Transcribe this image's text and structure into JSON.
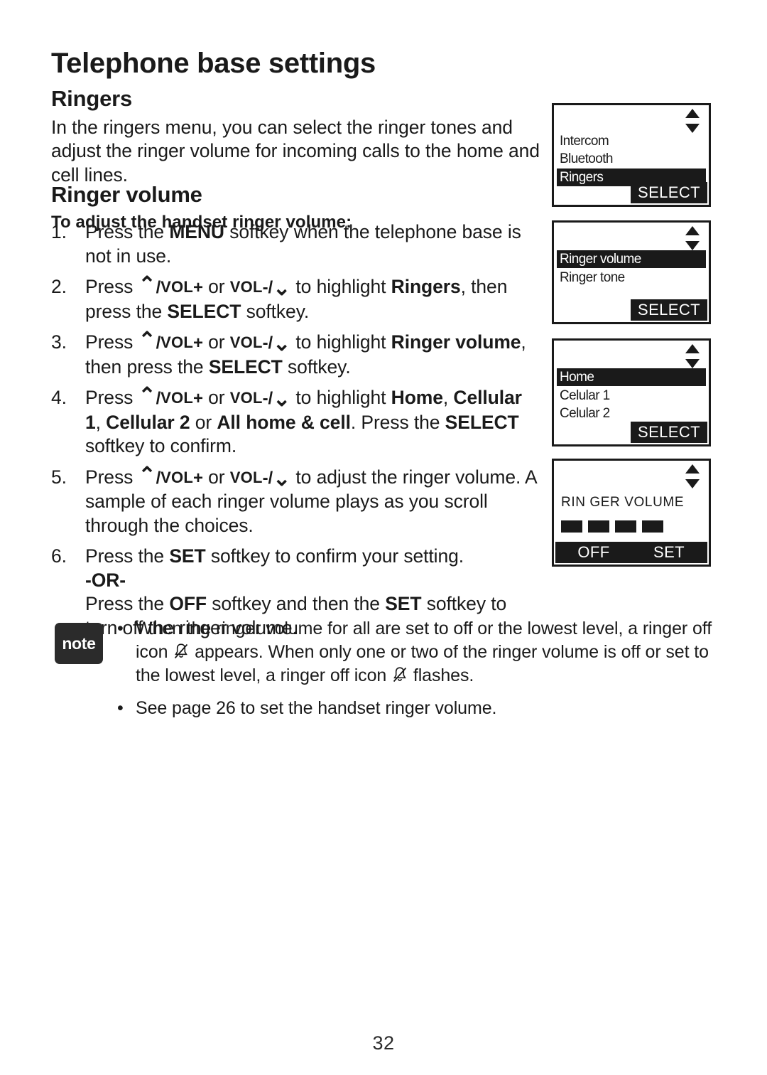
{
  "page": {
    "title": "Telephone base settings",
    "number": "32"
  },
  "sections": {
    "ringers_heading": "Ringers",
    "intro": "In the ringers menu, you can select the ringer tones and adjust the ringer volume for incoming calls to the home and cell lines.",
    "ringer_volume_heading": "Ringer volume",
    "procedure_heading": "To adjust the handset ringer volume:"
  },
  "tokens": {
    "chevron_up": "⌃",
    "chevron_down": "⌄",
    "vol_plus": "VOL",
    "vol_minus": "VOL",
    "plus": "+",
    "minus": "-",
    "slash": "/"
  },
  "steps": [
    {
      "num": "1.",
      "parts": [
        {
          "t": "Press the ",
          "b": false
        },
        {
          "t": "MENU",
          "b": true
        },
        {
          "t": " softkey when the telephone base is not in use.",
          "b": false
        }
      ]
    },
    {
      "num": "2.",
      "parts": [
        {
          "t": "Press ",
          "b": false
        },
        {
          "t": "__VOLUP__",
          "b": false
        },
        {
          "t": " or ",
          "b": false
        },
        {
          "t": "__VOLDN__",
          "b": false
        },
        {
          "t": " to highlight ",
          "b": false
        },
        {
          "t": "Ringers",
          "b": true
        },
        {
          "t": ", then press the ",
          "b": false
        },
        {
          "t": "SELECT",
          "b": true
        },
        {
          "t": " softkey.",
          "b": false
        }
      ]
    },
    {
      "num": "3.",
      "parts": [
        {
          "t": "Press ",
          "b": false
        },
        {
          "t": "__VOLUP__",
          "b": false
        },
        {
          "t": " or ",
          "b": false
        },
        {
          "t": "__VOLDN__",
          "b": false
        },
        {
          "t": " to highlight ",
          "b": false
        },
        {
          "t": "Ringer volume",
          "b": true
        },
        {
          "t": ", then press the ",
          "b": false
        },
        {
          "t": "SELECT",
          "b": true
        },
        {
          "t": " softkey.",
          "b": false
        }
      ]
    },
    {
      "num": "4.",
      "parts": [
        {
          "t": "Press ",
          "b": false
        },
        {
          "t": "__VOLUP__",
          "b": false
        },
        {
          "t": " or ",
          "b": false
        },
        {
          "t": "__VOLDN__",
          "b": false
        },
        {
          "t": " to highlight ",
          "b": false
        },
        {
          "t": "Home",
          "b": true
        },
        {
          "t": ", ",
          "b": false
        },
        {
          "t": "Cellular 1",
          "b": true
        },
        {
          "t": ", ",
          "b": false
        },
        {
          "t": "Cellular 2",
          "b": true
        },
        {
          "t": " or ",
          "b": false
        },
        {
          "t": "All home & cell",
          "b": true
        },
        {
          "t": ". Press the ",
          "b": false
        },
        {
          "t": "SELECT",
          "b": true
        },
        {
          "t": " softkey to confirm.",
          "b": false
        }
      ]
    },
    {
      "num": "5.",
      "parts": [
        {
          "t": "Press ",
          "b": false
        },
        {
          "t": "__VOLUP__",
          "b": false
        },
        {
          "t": " or ",
          "b": false
        },
        {
          "t": "__VOLDN__",
          "b": false
        },
        {
          "t": " to adjust the ringer volume. A sample of each ringer volume plays as you scroll through the choices.",
          "b": false
        }
      ]
    },
    {
      "num": "6.",
      "parts": [
        {
          "t": "Press the ",
          "b": false
        },
        {
          "t": "SET",
          "b": true
        },
        {
          "t": " softkey to confirm your setting.",
          "b": false
        },
        {
          "t": "__BR__",
          "b": false
        },
        {
          "t": "-OR-",
          "b": true
        },
        {
          "t": "__BR__",
          "b": false
        },
        {
          "t": "Press the ",
          "b": false
        },
        {
          "t": "OFF",
          "b": true
        },
        {
          "t": " softkey and then the ",
          "b": false
        },
        {
          "t": "SET",
          "b": true
        },
        {
          "t": " softkey to turn off the ringer volume.",
          "b": false
        }
      ]
    }
  ],
  "screens": [
    {
      "id": "menu-screen",
      "rows": [
        {
          "label": "Intercom",
          "selected": false
        },
        {
          "label": "Bluetooth",
          "selected": false
        },
        {
          "label": "Ringers",
          "selected": true
        }
      ],
      "softkeys": [
        {
          "label": "SELECT",
          "side": "right"
        }
      ]
    },
    {
      "id": "ringers-screen",
      "rows": [
        {
          "label": "Ringer volume",
          "selected": true
        },
        {
          "label": "Ringer tone",
          "selected": false
        }
      ],
      "softkeys": [
        {
          "label": "SELECT",
          "side": "right"
        }
      ]
    },
    {
      "id": "line-screen",
      "rows": [
        {
          "label": "Home",
          "selected": true
        },
        {
          "label": "Celular 1",
          "selected": false
        },
        {
          "label": "Celular 2",
          "selected": false
        }
      ],
      "softkeys": [
        {
          "label": "SELECT",
          "side": "right"
        }
      ]
    },
    {
      "id": "volume-screen",
      "title": "RIN GER VOLUME",
      "bars": 4,
      "softkeys": [
        {
          "label": "OFF",
          "side": "left"
        },
        {
          "label": "SET",
          "side": "right"
        }
      ]
    }
  ],
  "note": {
    "badge": "note",
    "items": [
      {
        "parts": [
          {
            "t": "When the ringer volume for all are set to off or the lowest level, a ringer off icon "
          },
          {
            "icon": "ringer-off-icon"
          },
          {
            "t": " appears. When only one or two of the ringer volume is off or set to the lowest level, a ringer off icon "
          },
          {
            "icon": "ringer-off-icon"
          },
          {
            "t": " flashes."
          }
        ]
      },
      {
        "parts": [
          {
            "t": "See page 26 to set the handset ringer volume."
          }
        ]
      }
    ]
  },
  "colors": {
    "ink": "#1a1a1a",
    "badge": "#2b2b2b",
    "paper": "#ffffff"
  }
}
